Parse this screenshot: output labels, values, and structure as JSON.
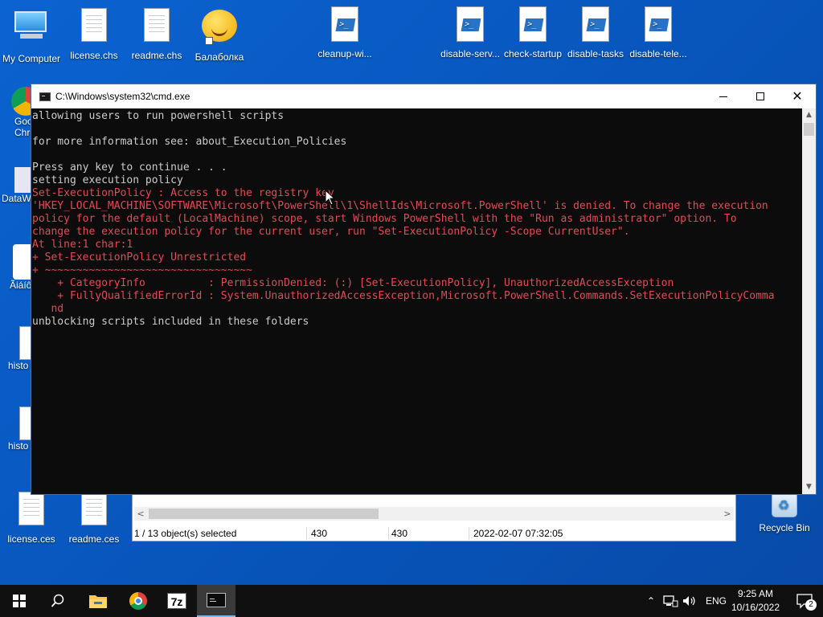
{
  "desktop": {
    "icons": [
      {
        "label": "My Computer",
        "icon": "computer-icon"
      },
      {
        "label": "license.chs",
        "icon": "document-icon"
      },
      {
        "label": "readme.chs",
        "icon": "document-icon"
      },
      {
        "label": "Балаболка",
        "icon": "balabolka-icon"
      },
      {
        "label": "cleanup-wi...",
        "icon": "powershell-script-icon"
      },
      {
        "label": "disable-serv...",
        "icon": "powershell-script-icon"
      },
      {
        "label": "check-startup",
        "icon": "powershell-script-icon"
      },
      {
        "label": "disable-tasks",
        "icon": "powershell-script-icon"
      },
      {
        "label": "disable-tele...",
        "icon": "powershell-script-icon"
      }
    ],
    "left_partial": [
      "Goo",
      "Chr",
      "DataW",
      "Ãiáíô",
      "histo",
      "histo"
    ],
    "bottom_icons": [
      {
        "label": "license.ces",
        "icon": "document-icon"
      },
      {
        "label": "readme.ces",
        "icon": "document-icon"
      }
    ],
    "recycle_bin": {
      "label": "Recycle Bin",
      "icon": "recycle-bin-icon"
    }
  },
  "explorer": {
    "status_selected": "1 / 13 object(s) selected",
    "status_size": "430",
    "status_size2": "430",
    "status_date": "2022-02-07 07:32:05"
  },
  "cmd": {
    "title": "C:\\Windows\\system32\\cmd.exe",
    "lines": [
      {
        "text": "allowing users to run powershell scripts",
        "kind": "normal"
      },
      {
        "text": "",
        "kind": "normal"
      },
      {
        "text": "for more information see: about_Execution_Policies",
        "kind": "normal"
      },
      {
        "text": "",
        "kind": "normal"
      },
      {
        "text": "Press any key to continue . . .",
        "kind": "normal"
      },
      {
        "text": "setting execution policy",
        "kind": "normal"
      },
      {
        "text": "Set-ExecutionPolicy : Access to the registry key",
        "kind": "error"
      },
      {
        "text": "'HKEY_LOCAL_MACHINE\\SOFTWARE\\Microsoft\\PowerShell\\1\\ShellIds\\Microsoft.PowerShell' is denied. To change the execution",
        "kind": "error"
      },
      {
        "text": "policy for the default (LocalMachine) scope, start Windows PowerShell with the \"Run as administrator\" option. To",
        "kind": "error"
      },
      {
        "text": "change the execution policy for the current user, run \"Set-ExecutionPolicy -Scope CurrentUser\".",
        "kind": "error"
      },
      {
        "text": "At line:1 char:1",
        "kind": "error"
      },
      {
        "text": "+ Set-ExecutionPolicy Unrestricted",
        "kind": "error"
      },
      {
        "text": "+ ~~~~~~~~~~~~~~~~~~~~~~~~~~~~~~~~~",
        "kind": "error"
      },
      {
        "text": "    + CategoryInfo          : PermissionDenied: (:) [Set-ExecutionPolicy], UnauthorizedAccessException",
        "kind": "error"
      },
      {
        "text": "    + FullyQualifiedErrorId : System.UnauthorizedAccessException,Microsoft.PowerShell.Commands.SetExecutionPolicyComma",
        "kind": "error"
      },
      {
        "text": "   nd",
        "kind": "error"
      },
      {
        "text": "unblocking scripts included in these folders",
        "kind": "normal"
      }
    ]
  },
  "taskbar": {
    "items": [
      "start-icon",
      "search-icon",
      "file-explorer-icon",
      "chrome-icon",
      "7zip-icon",
      "cmd-icon"
    ],
    "sevenzip_label": "7z",
    "language": "ENG",
    "time": "9:25 AM",
    "date": "10/16/2022",
    "notification_count": "2"
  },
  "colors": {
    "desktop": "#0a5bc4",
    "console_bg": "#0c0c0c",
    "console_text": "#cccccc",
    "console_error": "#e74856",
    "taskbar": "#101010"
  }
}
